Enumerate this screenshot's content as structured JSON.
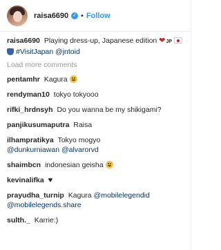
{
  "header": {
    "username": "raisa6690",
    "separator": "•",
    "follow_label": "Follow"
  },
  "caption": {
    "user": "raisa6690",
    "text_before": "Playing dress-up, Japanese edition",
    "flag_code": "JP",
    "hashtag": "#VisitJapan",
    "mention": "@jntoid"
  },
  "load_more_label": "Load more comments",
  "comments": [
    {
      "user": "pentamhr",
      "text": "Kagura"
    },
    {
      "user": "rendyman10",
      "text": "tokyo tokyooo"
    },
    {
      "user": "rifki_hrdnsyh",
      "text": "Do you wanna be my shikigami?"
    },
    {
      "user": "panjikusumaputra",
      "text": "Raisa"
    },
    {
      "user": "ilhampratikya",
      "text": "Tokyo mogyo",
      "mentions": "@dunkurniawan @alvarorvd"
    },
    {
      "user": "shaimbcn",
      "text": "indonesian geisha"
    },
    {
      "user": "kevinalifka",
      "text": "♥"
    },
    {
      "user": "prayudha_turnip",
      "text": "Kagura",
      "mentions": "@mobilelegendid @mobilelegends.share"
    },
    {
      "user": "sulth._",
      "text": "Karrie:)"
    }
  ]
}
